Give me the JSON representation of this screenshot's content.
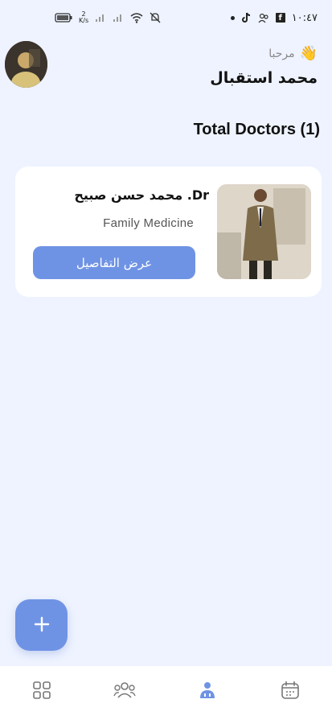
{
  "status_bar": {
    "time": "١٠:٤٧",
    "network_speed_top": "2",
    "network_speed_unit": "K/s",
    "icons": [
      "battery-icon",
      "network-speed-icon",
      "signal-icon",
      "signal-icon-2",
      "wifi-icon",
      "mute-icon",
      "notification-dot-icon",
      "tiktok-icon",
      "people-icon",
      "facebook-icon"
    ]
  },
  "header": {
    "greeting": "مرحبا",
    "greeting_icon": "waving-hand-icon",
    "user_name": "محمد استقبال"
  },
  "section": {
    "title": "Total Doctors (1)"
  },
  "doctors": [
    {
      "name": "Dr. محمد حسن صبيح",
      "specialty": "Family Medicine",
      "button_label": "عرض التفاصيل"
    }
  ],
  "fab": {
    "icon": "plus-icon"
  },
  "bottom_nav": {
    "items": [
      {
        "icon": "dashboard-grid-icon",
        "active": false
      },
      {
        "icon": "patients-group-icon",
        "active": false
      },
      {
        "icon": "doctor-icon",
        "active": true
      },
      {
        "icon": "calendar-icon",
        "active": false
      }
    ]
  },
  "colors": {
    "background": "#eef3ff",
    "accent": "#6f93e4",
    "card": "#ffffff",
    "nav_inactive": "#777777"
  }
}
